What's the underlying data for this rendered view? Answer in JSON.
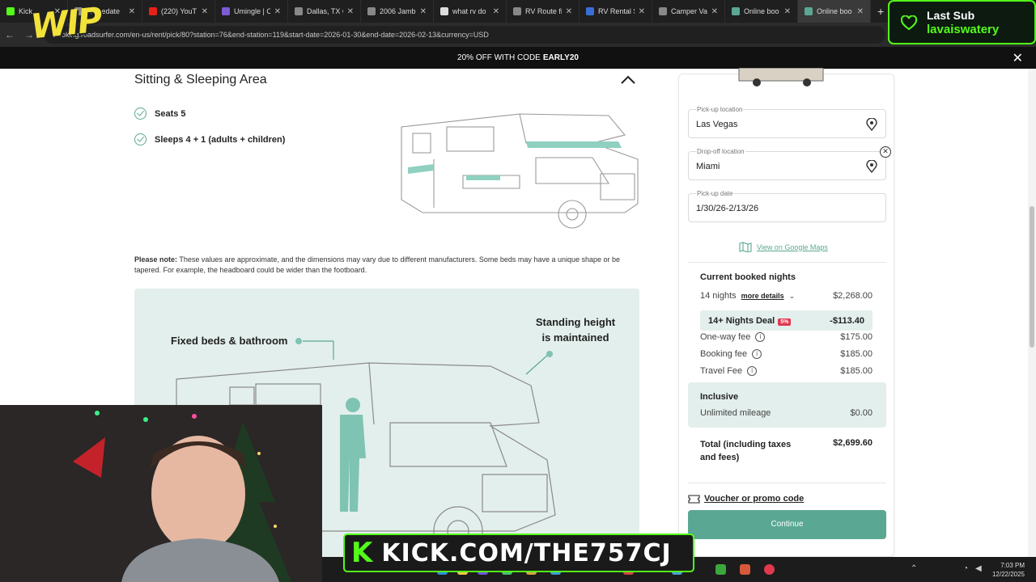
{
  "browser": {
    "tabs": [
      {
        "title": "Kick",
        "active": false
      },
      {
        "title": "(36) edate",
        "active": false
      },
      {
        "title": "(220) YouT",
        "active": false
      },
      {
        "title": "Umingle | C",
        "active": false
      },
      {
        "title": "Dallas, TX C",
        "active": false
      },
      {
        "title": "2006 Jamb",
        "active": false
      },
      {
        "title": "what rv do",
        "active": false
      },
      {
        "title": "RV Route fi",
        "active": false
      },
      {
        "title": "RV Rental S",
        "active": false
      },
      {
        "title": "Camper Va",
        "active": false
      },
      {
        "title": "Online boo",
        "active": false
      },
      {
        "title": "Online boo",
        "active": true
      }
    ],
    "url": "booking.roadsurfer.com/en-us/rent/pick/80?station=76&end-station=119&start-date=2026-01-30&end-date=2026-02-13&currency=USD"
  },
  "promo": {
    "text": "20% OFF WITH CODE",
    "code": "EARLY20"
  },
  "section": {
    "title": "Sitting & Sleeping Area",
    "features": [
      "Seats 5",
      "Sleeps 4 + 1 (adults + children)"
    ],
    "note_label": "Please note:",
    "note_text": "These values are approximate, and the dimensions may vary due to different manufacturers. Some beds may have a unique shape or be tapered. For example, the headboard could be wider than the footboard.",
    "diagram_label_fixed": "Fixed beds & bathroom",
    "diagram_label_standing": "Standing height is maintained"
  },
  "booking": {
    "pickup_label": "Pick-up location",
    "pickup_value": "Las Vegas",
    "dropoff_label": "Drop-off location",
    "dropoff_value": "Miami",
    "date_label": "Pick-up date",
    "date_value": "1/30/26-2/13/26",
    "maps_link": "View on Google Maps",
    "current_title": "Current booked nights",
    "nights_label": "14 nights",
    "more_details": "more details",
    "nights_price": "$2,268.00",
    "deal_label": "14+ Nights Deal",
    "deal_badge": "5%",
    "deal_value": "-$113.40",
    "fees": [
      {
        "label": "One-way fee",
        "value": "$175.00"
      },
      {
        "label": "Booking fee",
        "value": "$185.00"
      },
      {
        "label": "Travel Fee",
        "value": "$185.00"
      }
    ],
    "inclusive_title": "Inclusive",
    "mileage_label": "Unlimited mileage",
    "mileage_value": "$0.00",
    "total_label": "Total (including taxes and fees)",
    "total_value": "$2,699.60",
    "voucher": "Voucher or promo code",
    "continue": "Continue"
  },
  "overlay": {
    "last_sub_title": "Last Sub",
    "last_sub_name": "lavaiswatery",
    "kick_url": "KICK.COM/THE757CJ",
    "kick_k": "K",
    "wip": "WIP"
  },
  "taskbar": {
    "time": "7:03 PM",
    "date": "12/22/2025"
  },
  "colors": {
    "accent": "#5aa894",
    "teal_bg": "#e3efec",
    "kick_green": "#53fc18"
  }
}
